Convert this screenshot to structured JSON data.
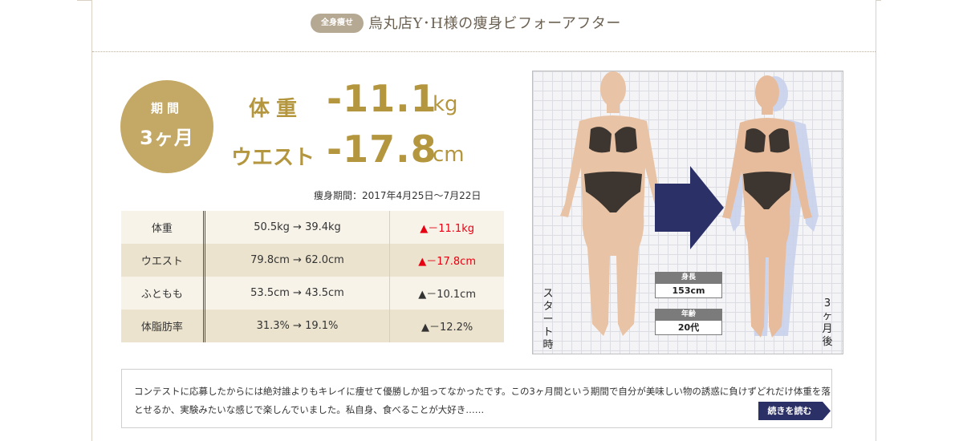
{
  "header": {
    "tag": "全身痩せ",
    "title": "烏丸店Y･H様の痩身ビフォーアフター"
  },
  "period_badge": {
    "line1": "期間",
    "line2": "3ヶ月"
  },
  "results": [
    {
      "label": "体重",
      "value": "-11.1",
      "unit": "kg"
    },
    {
      "label": "ウエスト",
      "value": "-17.8",
      "unit": "cm"
    }
  ],
  "slimming_period": "痩身期間：2017年4月25日〜7月22日",
  "table": {
    "rows": [
      {
        "item": "体重",
        "change": "50.5kg → 39.4kg",
        "diff": "▲－11.1kg",
        "highlight": true
      },
      {
        "item": "ウエスト",
        "change": "79.8cm → 62.0cm",
        "diff": "▲－17.8cm",
        "highlight": true
      },
      {
        "item": "ふともも",
        "change": "53.5cm → 43.5cm",
        "diff": "▲－10.1cm",
        "highlight": false
      },
      {
        "item": "体脂肪率",
        "change": "31.3% → 19.1%",
        "diff": "▲－12.2%",
        "highlight": false
      }
    ]
  },
  "photo": {
    "before_label": "スタート時",
    "after_label": "3ヶ月後",
    "height_label": "身長",
    "height_value": "153cm",
    "age_label": "年齢",
    "age_value": "20代",
    "arrow_icon": "right-arrow-icon"
  },
  "summary": {
    "text": "コンテストに応募したからには絶対誰よりもキレイに痩せて優勝しか狙ってなかったです。この3ヶ月間という期間で自分が美味しい物の誘惑に負けずどれだけ体重を落とせるか、実験みたいな感じで楽しんでいました。私自身、食べることが大好き……",
    "read_more": "続きを読む"
  },
  "colors": {
    "gold": "#c4a865",
    "gold_text": "#b4963f",
    "tag_bg": "#b6a993",
    "red": "#e60012",
    "navy": "#2b3066"
  }
}
